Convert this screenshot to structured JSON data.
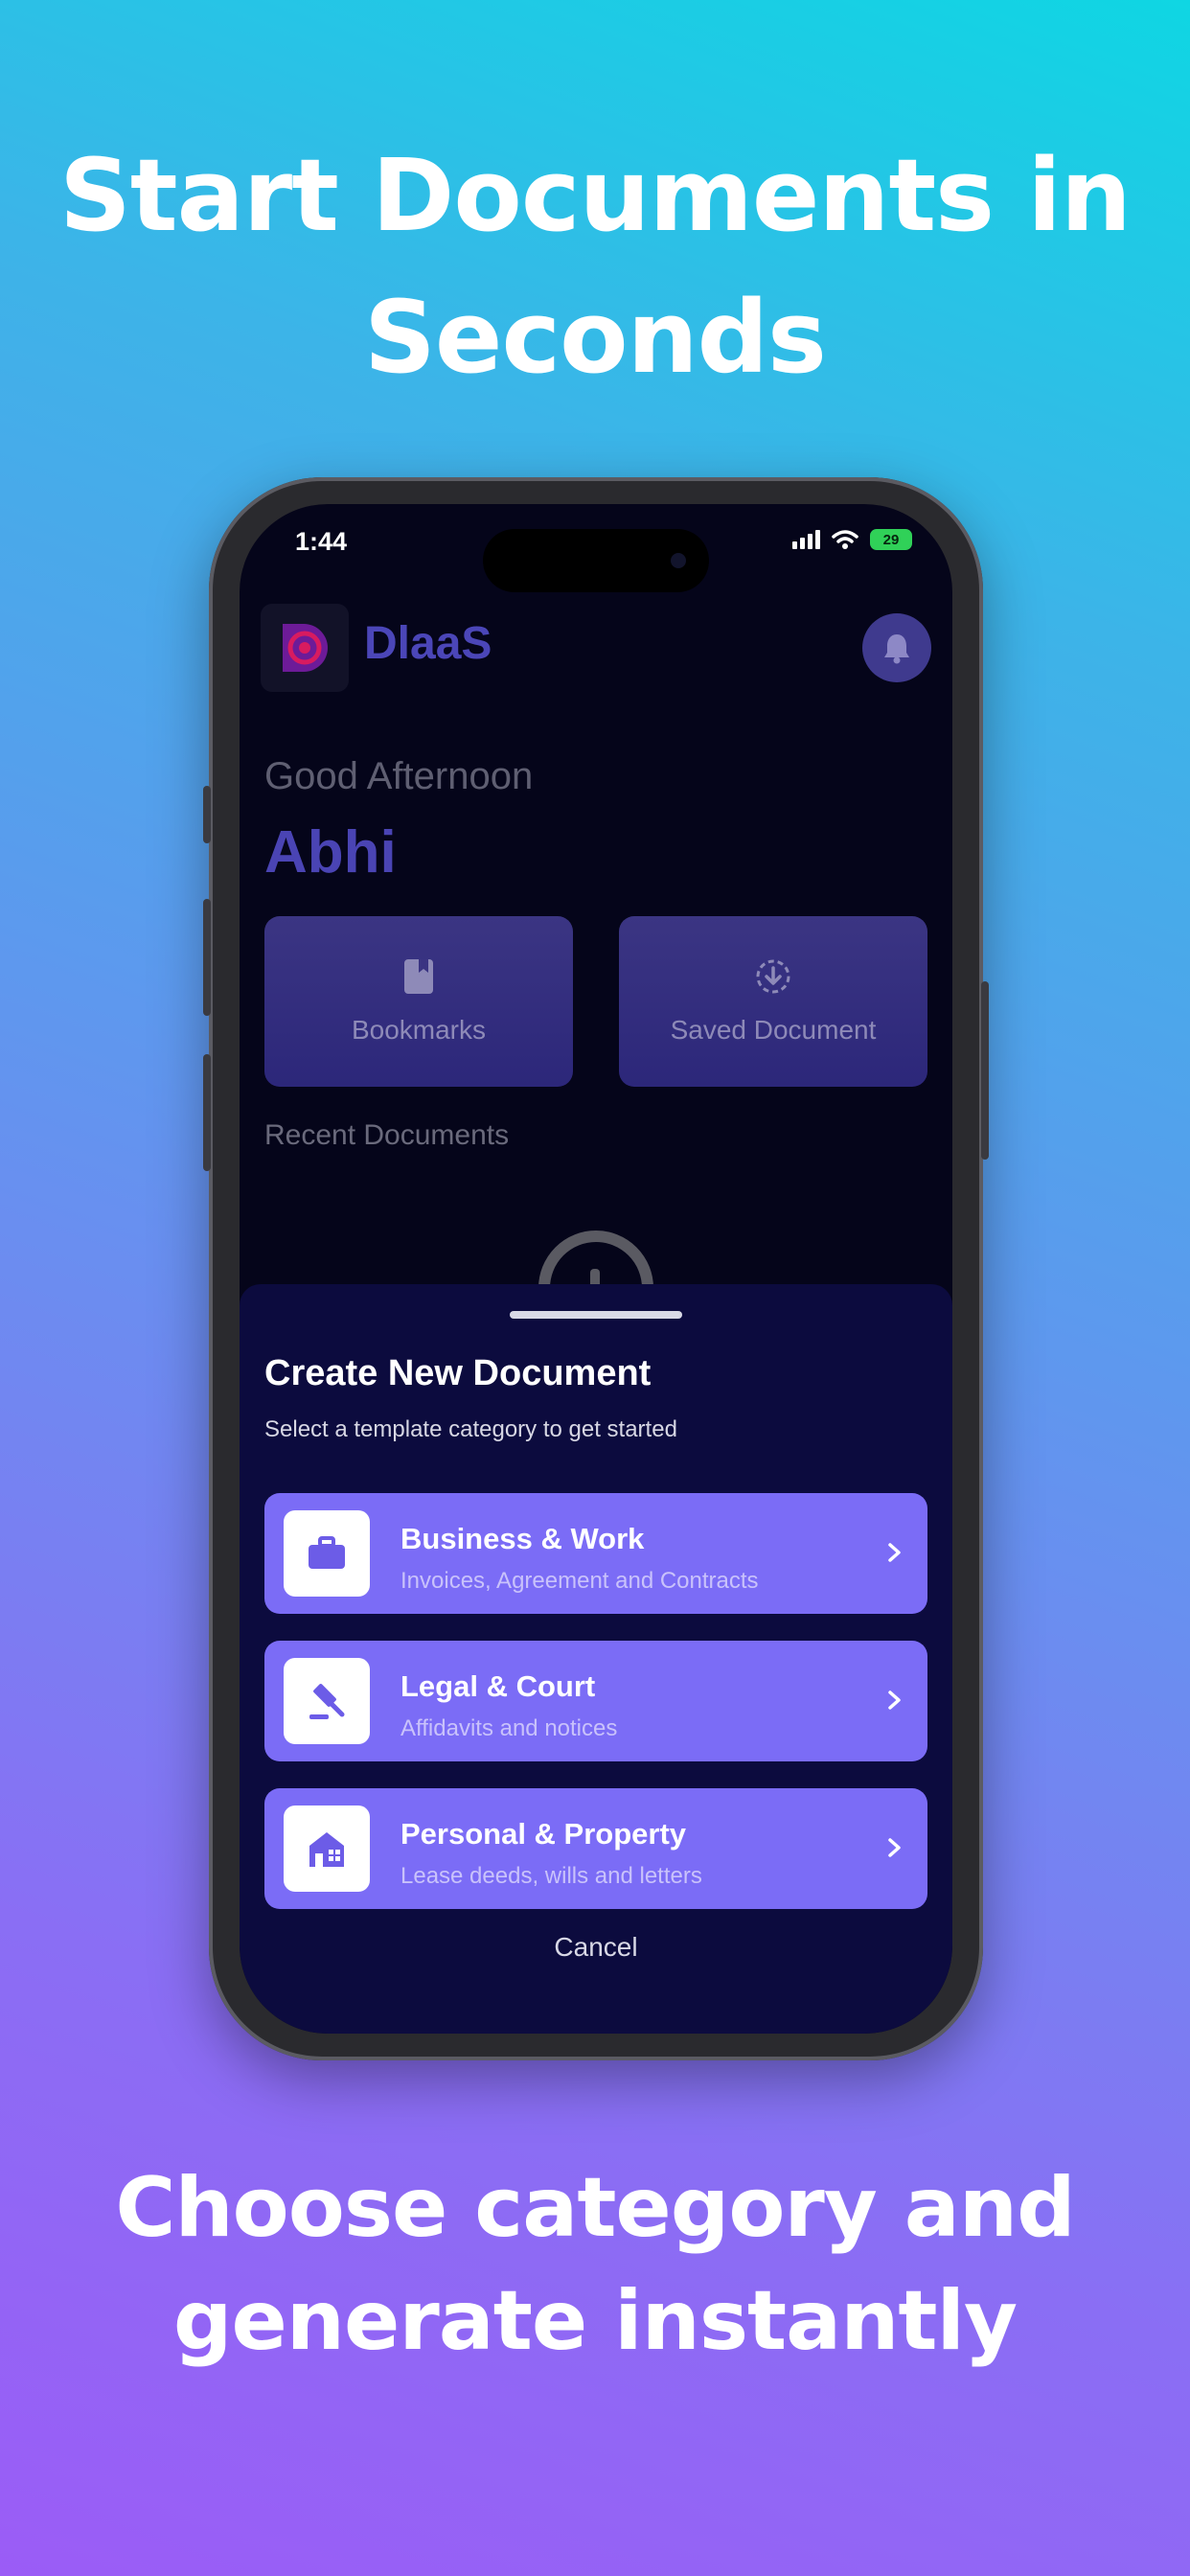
{
  "hero": {
    "title_line1": "Start Documents in",
    "title_line2": "Seconds",
    "bottom_line1": "Choose category and",
    "bottom_line2": "generate instantly"
  },
  "status_bar": {
    "time": "1:44",
    "battery": "29"
  },
  "app": {
    "name": "DlaaS",
    "greeting": "Good Afternoon",
    "username": "Abhi"
  },
  "quick_actions": [
    {
      "label": "Bookmarks",
      "icon": "bookmark-icon"
    },
    {
      "label": "Saved Document",
      "icon": "download-icon"
    }
  ],
  "recent_label": "Recent Documents",
  "sheet": {
    "title": "Create New Document",
    "subtitle": "Select a template category to get started",
    "options": [
      {
        "title": "Business & Work",
        "subtitle": "Invoices, Agreement and Contracts",
        "icon": "briefcase-icon"
      },
      {
        "title": "Legal & Court",
        "subtitle": "Affidavits and notices",
        "icon": "gavel-icon"
      },
      {
        "title": "Personal & Property",
        "subtitle": "Lease deeds, wills and letters",
        "icon": "house-icon"
      }
    ],
    "cancel_label": "Cancel"
  },
  "colors": {
    "accent": "#7b6cf6",
    "sheet_bg": "#0c0b3e",
    "screen_bg": "#05051a"
  }
}
